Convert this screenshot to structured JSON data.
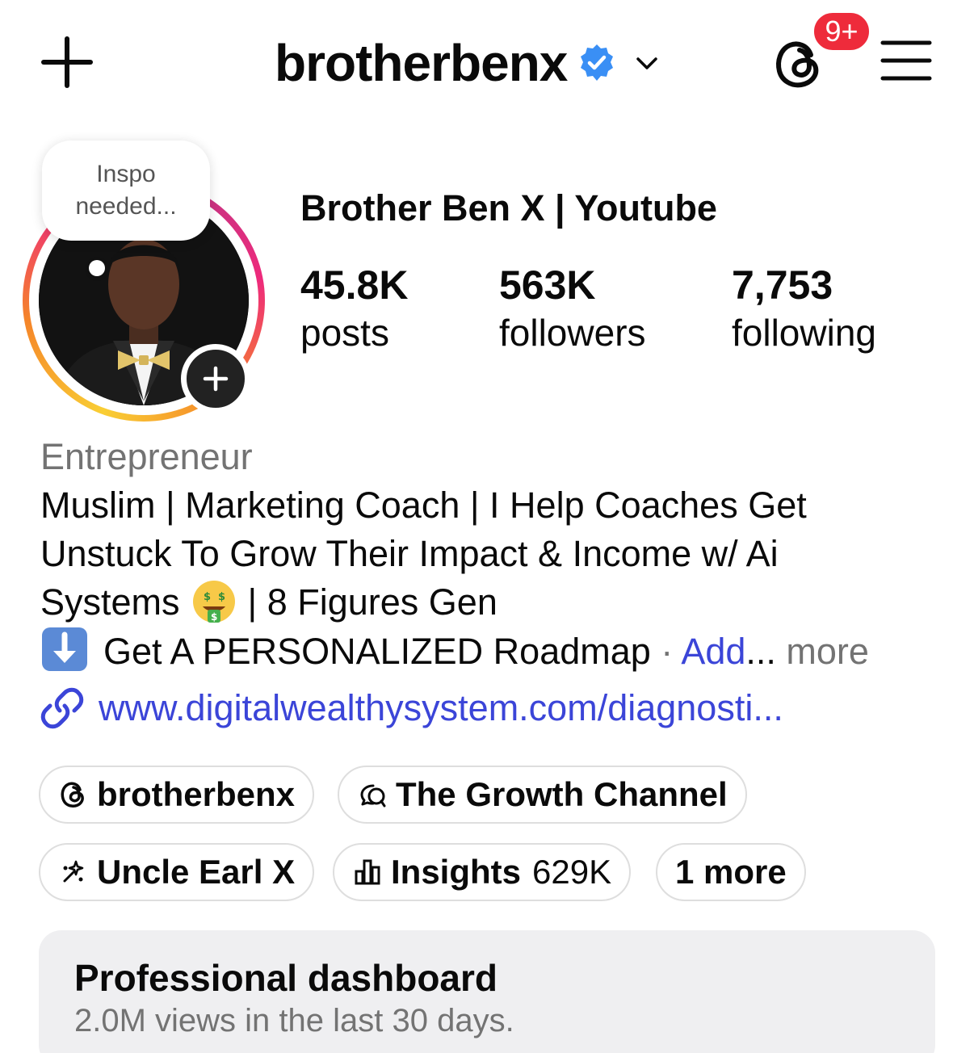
{
  "header": {
    "username": "brotherbenx",
    "notifications_badge": "9+",
    "icons": [
      "plus-icon",
      "verified-badge-icon",
      "chevron-down-icon",
      "threads-icon",
      "menu-icon"
    ]
  },
  "profile": {
    "note": "Inspo\nneeded...",
    "display_name": "Brother Ben X | Youtube",
    "stats": [
      {
        "value": "45.8K",
        "label": "posts"
      },
      {
        "value": "563K",
        "label": "followers"
      },
      {
        "value": "7,753",
        "label": "following"
      }
    ]
  },
  "bio": {
    "category": "Entrepreneur",
    "line1": "Muslim | Marketing Coach | I Help Coaches Get",
    "line2": "Unstuck To Grow Their Impact & Income w/ Ai",
    "line3_start": "Systems",
    "line3_end": "| 8 Figures Gen",
    "line4_text": "Get A PERSONALIZED Roadmap",
    "line4_sep": " · ",
    "line4_add": "Add",
    "line4_more_prefix": "... ",
    "line4_more": "more",
    "link": "www.digitalwealthysystem.com/diagnosti..."
  },
  "chips": {
    "threads": "brotherbenx",
    "channel": "The Growth Channel",
    "uncle": "Uncle Earl X",
    "insights_label": "Insights",
    "insights_value": "629K",
    "more": "1 more"
  },
  "dashboard": {
    "title": "Professional dashboard",
    "subtitle": "2.0M views in the last 30 days."
  },
  "colors": {
    "link_blue": "#3b45d8",
    "verified_blue": "#3a8ff5",
    "badge_red": "#ee2b3b",
    "muted_gray": "#737373"
  }
}
